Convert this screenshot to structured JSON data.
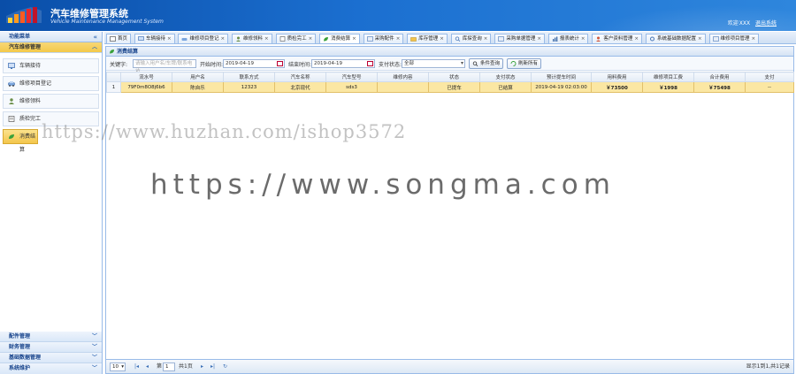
{
  "header": {
    "title": "汽车维修管理系统",
    "subtitle": "Vehicle Maintenance Management System",
    "welcome": "欢迎",
    "username": "XXX",
    "logout": "退出系统"
  },
  "sidebar": {
    "title": "功能菜单",
    "collapse_icon": "«",
    "active_group": "汽车维修管理",
    "items": [
      {
        "label": "车辆接待",
        "icon": "monitor-icon"
      },
      {
        "label": "维修项目登记",
        "icon": "car-icon"
      },
      {
        "label": "维修领料",
        "icon": "person-icon"
      },
      {
        "label": "质检完工",
        "icon": "document-icon"
      },
      {
        "label": "消费结算",
        "icon": "leaf-icon"
      }
    ],
    "groups": [
      "配件管理",
      "财务管理",
      "基础数据管理",
      "系统维护"
    ]
  },
  "tabs": [
    {
      "label": "首页",
      "closable": false
    },
    {
      "label": "车辆接待",
      "closable": true
    },
    {
      "label": "维修项目登记",
      "closable": true
    },
    {
      "label": "维修领料",
      "closable": true
    },
    {
      "label": "质检完工",
      "closable": true
    },
    {
      "label": "消费结算",
      "closable": true,
      "active": true
    },
    {
      "label": "采购配件",
      "closable": true
    },
    {
      "label": "库存管理",
      "closable": true
    },
    {
      "label": "库探查询",
      "closable": true
    },
    {
      "label": "采购单据管理",
      "closable": true
    },
    {
      "label": "报表统计",
      "closable": true
    },
    {
      "label": "客户资料管理",
      "closable": true
    },
    {
      "label": "系统基础数据配置",
      "closable": true
    },
    {
      "label": "维修项目管理",
      "closable": true
    }
  ],
  "panel": {
    "title": "消费结算"
  },
  "filters": {
    "keyword_label": "关键字:",
    "keyword_placeholder": "请输入用户名/车牌/联系电话",
    "start_label": "开始时间:",
    "start_value": "2019-04-19",
    "end_label": "结束时间:",
    "end_value": "2019-04-19",
    "pay_label": "支付状态:",
    "pay_value": "全部",
    "search_btn": "条件查询",
    "refresh_btn": "刷新所有"
  },
  "grid": {
    "columns": [
      "流水号",
      "用户名",
      "联系方式",
      "汽车名称",
      "汽车型号",
      "维修内容",
      "状态",
      "支付状态",
      "预计提车时间",
      "用料费用",
      "维修项目工费",
      "合计费用",
      "支付"
    ],
    "rows": [
      {
        "rownum": "1",
        "serial": "79F0m8O8j6b6",
        "user": "陈自乐",
        "phone": "12323",
        "car_name": "北京现代",
        "car_model": "sds3",
        "content": "",
        "status": "已提车",
        "pay_status": "已结算",
        "pickup_time": "2019-04-19 02:03:00",
        "material_fee": "￥73500",
        "labor_fee": "￥1998",
        "total_fee": "￥75498",
        "pay": "--"
      }
    ]
  },
  "pager": {
    "page_size": "10",
    "page_label_pre": "第",
    "page_value": "1",
    "page_label_post": "共1页",
    "summary": "显示1到1,共1记录"
  },
  "watermarks": {
    "line1": "https://www.huzhan.com/ishop3572",
    "line2": "https://www.songma.com"
  },
  "colors": {
    "header_blue": "#1b6fd0",
    "selected_row": "#fbe7a3",
    "price_orange": "#f39c12",
    "price_blue": "#2a8ac9",
    "price_red": "#e0102a"
  }
}
